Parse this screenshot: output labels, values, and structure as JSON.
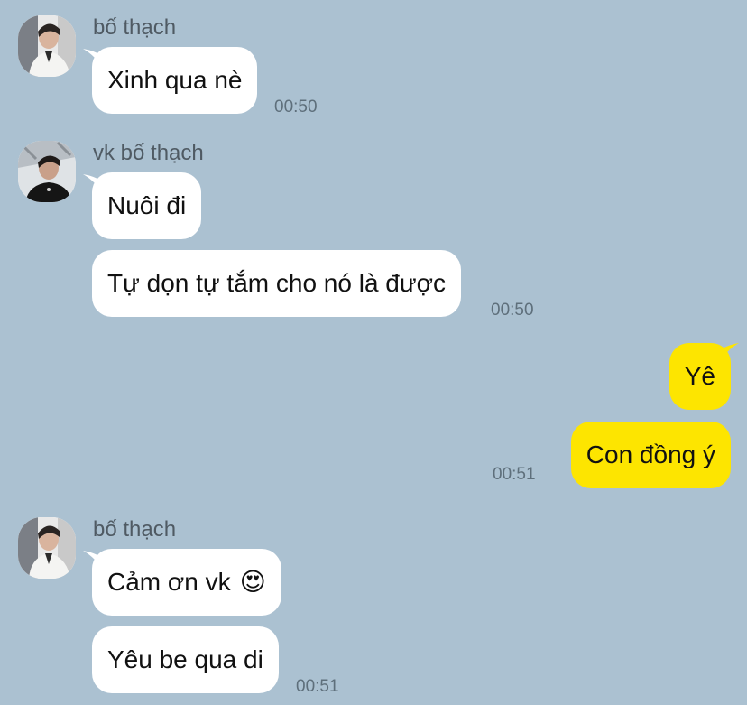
{
  "colors": {
    "background": "#abc1d1",
    "incoming_bubble": "#ffffff",
    "outgoing_bubble": "#fde500"
  },
  "messages": {
    "g1": {
      "sender": "bố thạch",
      "m1": "Xinh qua nè",
      "time": "00:50"
    },
    "g2": {
      "sender": "vk bố thạch",
      "m1": "Nuôi đi",
      "m2": "Tự dọn tự tắm cho nó là được",
      "time": "00:50"
    },
    "g3": {
      "m1": "Yê",
      "m2": "Con đồng ý",
      "time": "00:51"
    },
    "g4": {
      "sender": "bố thạch",
      "m1": "Cảm ơn vk",
      "emoji": "😍",
      "m2": "Yêu be qua di",
      "time": "00:51"
    }
  },
  "icons": {
    "avatar": "profile-photo-icon",
    "emoji": "heart-eyes-emoji-icon"
  }
}
